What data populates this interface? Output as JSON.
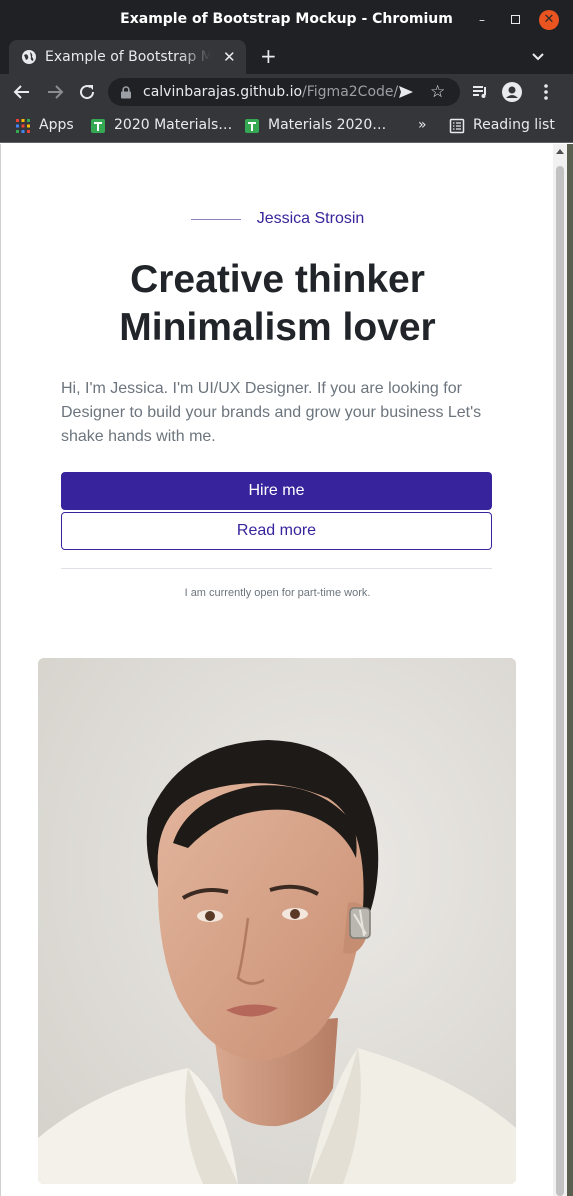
{
  "window": {
    "title": "Example of Bootstrap Mockup - Chromium",
    "minimize_glyph": "–",
    "close_glyph": "✕"
  },
  "tab": {
    "title": "Example of Bootstrap Mockup",
    "close_glyph": "✕",
    "new_tab_glyph": "+"
  },
  "address_bar": {
    "host": "calvinbarajas.github.io",
    "path": "/Figma2Code/",
    "star_glyph": "☆"
  },
  "bookmarks": {
    "apps": "Apps",
    "item1": "2020 Materials…",
    "item2": "Materials 2020…",
    "overflow": "»",
    "reading_list": "Reading list"
  },
  "hero": {
    "eyebrow_name": "Jessica Strosin",
    "headline_line1": "Creative thinker",
    "headline_line2": "Minimalism lover",
    "intro": "Hi, I'm Jessica. I'm UI/UX Designer. If you are looking for Designer to build your brands and grow your business Let's shake hands with me.",
    "hire_button": "Hire me",
    "read_more_button": "Read more",
    "availability_note": "I am currently open for part-time work."
  },
  "colors": {
    "accent": "#37249d",
    "chrome_dark": "#202124",
    "chrome_toolbar": "#35363a",
    "text_dark": "#212529",
    "text_muted": "#6c757d"
  }
}
